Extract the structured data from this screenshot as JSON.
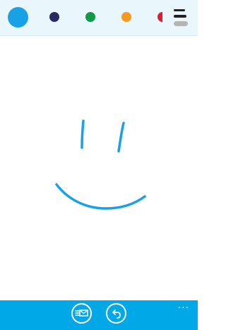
{
  "palette": {
    "colors": [
      {
        "name": "sky-blue",
        "hex": "#18a1e6",
        "selected": true
      },
      {
        "name": "navy",
        "hex": "#2a2a63",
        "selected": false
      },
      {
        "name": "green",
        "hex": "#109a45",
        "selected": false
      },
      {
        "name": "orange",
        "hex": "#f39a1f",
        "selected": false
      },
      {
        "name": "red",
        "hex": "#e31b2e",
        "selected": false
      }
    ],
    "stroke_picker_icon": "stroke-width-icon"
  },
  "canvas": {
    "background": "#ffffff",
    "ink_color": "#18a1e6",
    "drawing": "smiley face"
  },
  "app_bar": {
    "background": "#00a8e8",
    "buttons": [
      {
        "icon": "send-message-icon"
      },
      {
        "icon": "undo-icon"
      }
    ],
    "more_label": "..."
  }
}
